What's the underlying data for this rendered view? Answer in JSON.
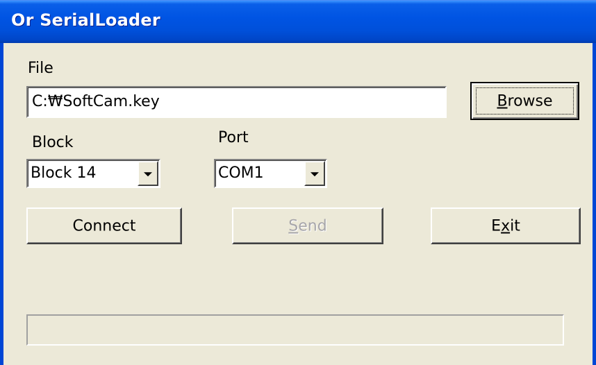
{
  "window": {
    "title": "Or SerialLoader"
  },
  "file": {
    "label": "File",
    "value": "C:₩SoftCam.key"
  },
  "browse_button": {
    "label_pre": "",
    "label_access": "B",
    "label_post": "rowse"
  },
  "block": {
    "label": "Block",
    "selected": "Block 14"
  },
  "port": {
    "label": "Port",
    "selected": "COM1"
  },
  "connect_button": {
    "label": "Connect"
  },
  "send_button": {
    "label_pre": "",
    "label_access": "S",
    "label_post": "end",
    "enabled": false
  },
  "exit_button": {
    "label_pre": "E",
    "label_access": "x",
    "label_post": "it"
  },
  "progress": {
    "value": 0
  },
  "colors": {
    "titlebar": "#0054E3",
    "dialog_bg": "#ECE9D8",
    "disabled_text": "#A7A6AA"
  }
}
